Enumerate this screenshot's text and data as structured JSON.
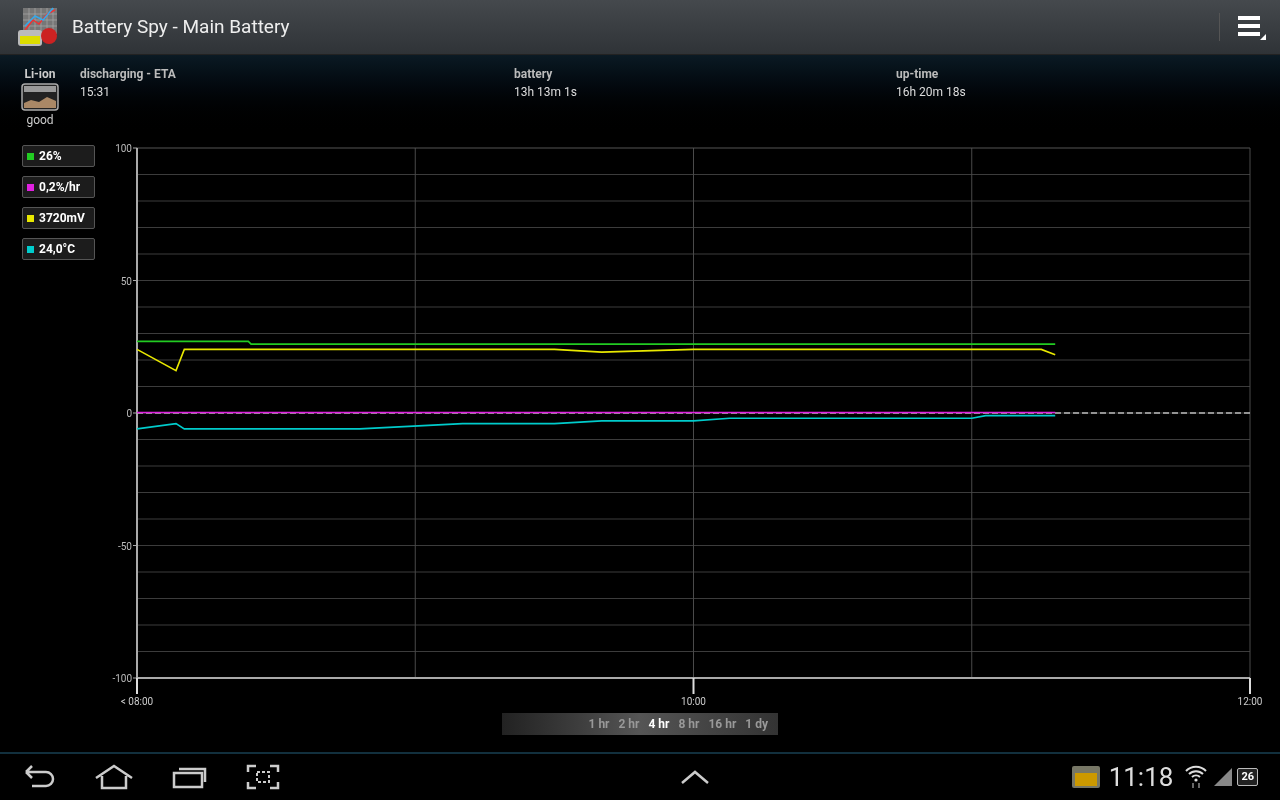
{
  "title_bar": {
    "title": "Battery Spy - Main Battery"
  },
  "battery": {
    "type": "Li-ion",
    "health": "good"
  },
  "info": [
    {
      "label": "discharging - ETA",
      "value": "15:31"
    },
    {
      "label": "battery",
      "value": "13h 13m 1s"
    },
    {
      "label": "up-time",
      "value": "16h 20m 18s"
    }
  ],
  "legend": [
    {
      "text": "26%",
      "color": "#22cc22"
    },
    {
      "text": "0,2%/hr",
      "color": "#e020e0"
    },
    {
      "text": "3720mV",
      "color": "#e8e800"
    },
    {
      "text": "24,0°C",
      "color": "#00cccc"
    }
  ],
  "chart_data": {
    "type": "line",
    "x": [
      8.0,
      8.14,
      8.17,
      8.4,
      8.41,
      8.8,
      9.17,
      9.5,
      9.67,
      10.0,
      10.13,
      10.5,
      11.0,
      11.05,
      11.25,
      11.3
    ],
    "xlim": [
      8,
      12
    ],
    "ylim": [
      -100,
      100
    ],
    "xticks": [
      {
        "value": 8,
        "label": "< 08:00"
      },
      {
        "value": 10,
        "label": "10:00"
      },
      {
        "value": 12,
        "label": "12:00"
      }
    ],
    "yticks": [
      100,
      50,
      0,
      -50,
      -100
    ],
    "grid": true,
    "ref_lines": [
      {
        "axis": "y",
        "value": 0
      }
    ],
    "series": [
      {
        "color": "#22cc22",
        "values": [
          27,
          27,
          27,
          27,
          26,
          26,
          26,
          26,
          26,
          26,
          26,
          26,
          26,
          26,
          26,
          26
        ]
      },
      {
        "color": "#e020e0",
        "values": [
          0.2,
          0.2,
          0.2,
          0.2,
          0.2,
          0.2,
          0.2,
          0.2,
          0.2,
          0.2,
          0.2,
          0.2,
          0.2,
          0.2,
          0.2,
          0.2
        ]
      },
      {
        "color": "#e8e800",
        "values": [
          24,
          16,
          24,
          24,
          24,
          24,
          24,
          24,
          23,
          24,
          24,
          24,
          24,
          24,
          24,
          22
        ]
      },
      {
        "color": "#00cccc",
        "values": [
          -6,
          -4,
          -6,
          -6,
          -6,
          -6,
          -4,
          -4,
          -3,
          -3,
          -2,
          -2,
          -2,
          -1,
          -1,
          -1
        ]
      }
    ]
  },
  "time_ranges": [
    {
      "label": "1 hr",
      "selected": false
    },
    {
      "label": "2 hr",
      "selected": false
    },
    {
      "label": "4 hr",
      "selected": true
    },
    {
      "label": "8 hr",
      "selected": false
    },
    {
      "label": "16 hr",
      "selected": false
    },
    {
      "label": "1 dy",
      "selected": false
    }
  ],
  "status_bar": {
    "time": "11:18",
    "battery": "26"
  }
}
